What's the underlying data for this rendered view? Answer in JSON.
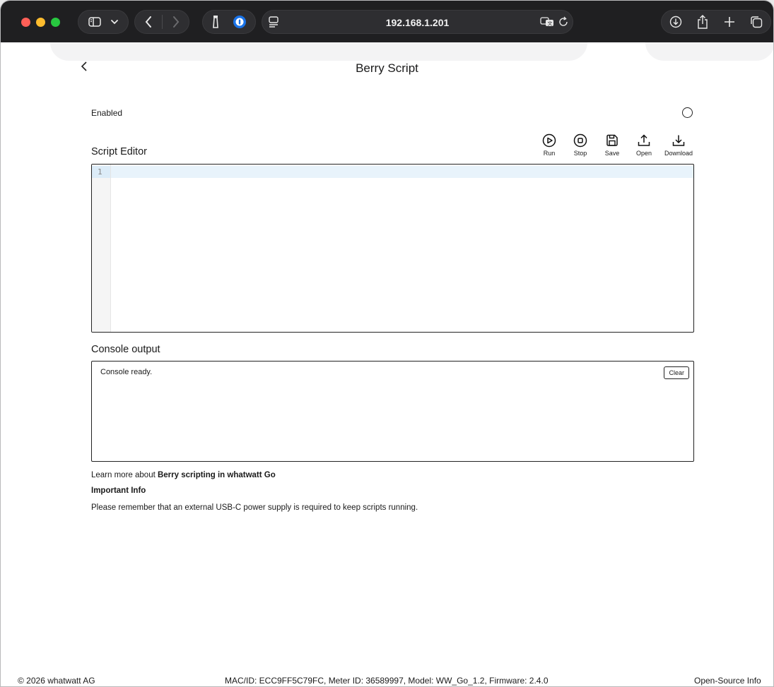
{
  "browser": {
    "address": "192.168.1.201",
    "traffic_lights": [
      "#ff5f57",
      "#febc2e",
      "#28c840"
    ],
    "icons": [
      "sidebar-icon",
      "chevron-down-icon",
      "back-icon",
      "forward-icon",
      "cleaner-icon",
      "password-icon",
      "reader-icon",
      "translate-icon",
      "reload-icon",
      "download-icon",
      "share-icon",
      "new-tab-icon",
      "tabs-overview-icon"
    ]
  },
  "page": {
    "title": "Berry Script",
    "back_icon": "chevron-left-icon",
    "enabled_label": "Enabled",
    "enabled": false
  },
  "editor": {
    "title": "Script Editor",
    "line_number": "1",
    "content": "",
    "actions": [
      {
        "label": "Run",
        "icon": "play-icon"
      },
      {
        "label": "Stop",
        "icon": "stop-icon"
      },
      {
        "label": "Save",
        "icon": "save-icon"
      },
      {
        "label": "Open",
        "icon": "upload-icon"
      },
      {
        "label": "Download",
        "icon": "download-icon"
      }
    ]
  },
  "console": {
    "title": "Console output",
    "text": "Console ready.",
    "clear_label": "Clear"
  },
  "info": {
    "learn_prefix": "Learn more about ",
    "learn_link": "Berry scripting in whatwatt Go",
    "important_title": "Important Info",
    "important_text": "Please remember that an external USB-C power supply is required to keep scripts running."
  },
  "footer": {
    "copyright": "© 2026 whatwatt AG",
    "device_info": "MAC/ID: ECC9FF5C79FC, Meter ID: 36589997, Model: WW_Go_1.2, Firmware: 2.4.0",
    "open_source": "Open-Source Info"
  }
}
